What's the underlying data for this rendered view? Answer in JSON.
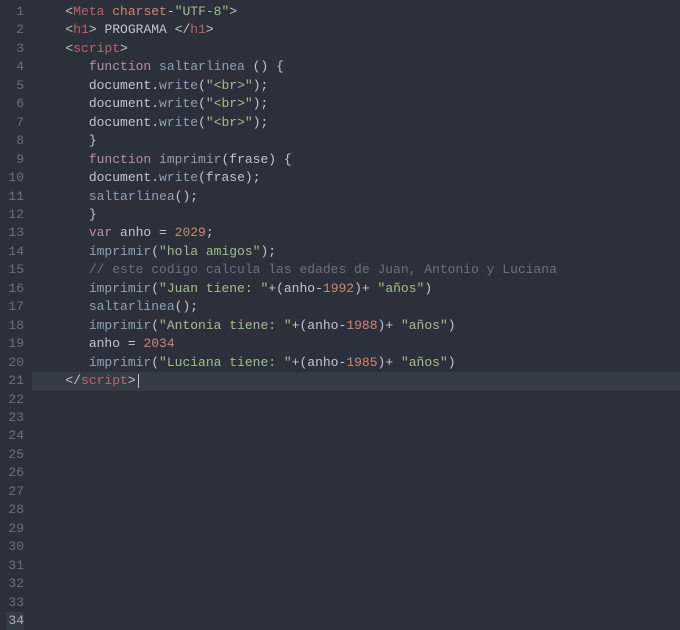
{
  "editor": {
    "active_line": 34,
    "lines": [
      {
        "n": 1,
        "indent": 1,
        "tokens": [
          {
            "c": "t-punc",
            "t": "<"
          },
          {
            "c": "t-tag",
            "t": "Meta"
          },
          {
            "c": "t-punc",
            "t": " "
          },
          {
            "c": "t-attr",
            "t": "charset"
          },
          {
            "c": "t-punc",
            "t": "-"
          },
          {
            "c": "t-str",
            "t": "\"UTF-8\""
          },
          {
            "c": "t-punc",
            "t": ">"
          }
        ]
      },
      {
        "n": 2,
        "indent": 1,
        "tokens": [
          {
            "c": "t-punc",
            "t": "<"
          },
          {
            "c": "t-tag",
            "t": "h1"
          },
          {
            "c": "t-punc",
            "t": "> "
          },
          {
            "c": "t-ident",
            "t": "PROGRAMA"
          },
          {
            "c": "t-punc",
            "t": " </"
          },
          {
            "c": "t-tag",
            "t": "h1"
          },
          {
            "c": "t-punc",
            "t": ">"
          }
        ]
      },
      {
        "n": 3,
        "indent": 0,
        "tokens": []
      },
      {
        "n": 4,
        "indent": 0,
        "tokens": []
      },
      {
        "n": 5,
        "indent": 1,
        "tokens": [
          {
            "c": "t-punc",
            "t": "<"
          },
          {
            "c": "t-tag",
            "t": "script"
          },
          {
            "c": "t-punc",
            "t": ">"
          }
        ]
      },
      {
        "n": 6,
        "indent": 0,
        "tokens": []
      },
      {
        "n": 7,
        "indent": 2,
        "tokens": [
          {
            "c": "t-kw",
            "t": "function"
          },
          {
            "c": "t-punc",
            "t": " "
          },
          {
            "c": "t-fn",
            "t": "saltarlinea"
          },
          {
            "c": "t-punc",
            "t": " () {"
          }
        ]
      },
      {
        "n": 8,
        "indent": 0,
        "tokens": []
      },
      {
        "n": 9,
        "indent": 2,
        "tokens": [
          {
            "c": "t-ident",
            "t": "document"
          },
          {
            "c": "t-punc",
            "t": "."
          },
          {
            "c": "t-fn",
            "t": "write"
          },
          {
            "c": "t-punc",
            "t": "("
          },
          {
            "c": "t-str",
            "t": "\"<br>\""
          },
          {
            "c": "t-punc",
            "t": ");"
          }
        ]
      },
      {
        "n": 10,
        "indent": 2,
        "tokens": [
          {
            "c": "t-ident",
            "t": "document"
          },
          {
            "c": "t-punc",
            "t": "."
          },
          {
            "c": "t-fn",
            "t": "write"
          },
          {
            "c": "t-punc",
            "t": "("
          },
          {
            "c": "t-str",
            "t": "\"<br>\""
          },
          {
            "c": "t-punc",
            "t": ");"
          }
        ]
      },
      {
        "n": 11,
        "indent": 2,
        "tokens": [
          {
            "c": "t-ident",
            "t": "document"
          },
          {
            "c": "t-punc",
            "t": "."
          },
          {
            "c": "t-fn",
            "t": "write"
          },
          {
            "c": "t-punc",
            "t": "("
          },
          {
            "c": "t-str",
            "t": "\"<br>\""
          },
          {
            "c": "t-punc",
            "t": ");"
          }
        ]
      },
      {
        "n": 12,
        "indent": 0,
        "tokens": []
      },
      {
        "n": 13,
        "indent": 2,
        "tokens": [
          {
            "c": "t-punc",
            "t": "}"
          }
        ]
      },
      {
        "n": 14,
        "indent": 0,
        "tokens": []
      },
      {
        "n": 15,
        "indent": 2,
        "tokens": [
          {
            "c": "t-kw",
            "t": "function"
          },
          {
            "c": "t-punc",
            "t": " "
          },
          {
            "c": "t-fn",
            "t": "ímprimir"
          },
          {
            "c": "t-punc",
            "t": "("
          },
          {
            "c": "t-ident",
            "t": "frase"
          },
          {
            "c": "t-punc",
            "t": ") {"
          }
        ]
      },
      {
        "n": 16,
        "indent": 2,
        "tokens": [
          {
            "c": "t-ident",
            "t": "document"
          },
          {
            "c": "t-punc",
            "t": "."
          },
          {
            "c": "t-fn",
            "t": "write"
          },
          {
            "c": "t-punc",
            "t": "("
          },
          {
            "c": "t-ident",
            "t": "frase"
          },
          {
            "c": "t-punc",
            "t": ");"
          }
        ]
      },
      {
        "n": 17,
        "indent": 2,
        "tokens": [
          {
            "c": "t-fn",
            "t": "saltarlinea"
          },
          {
            "c": "t-punc",
            "t": "();"
          }
        ]
      },
      {
        "n": 18,
        "indent": 2,
        "tokens": [
          {
            "c": "t-punc",
            "t": "}"
          }
        ]
      },
      {
        "n": 19,
        "indent": 0,
        "tokens": []
      },
      {
        "n": 20,
        "indent": 2,
        "tokens": [
          {
            "c": "t-kw",
            "t": "var"
          },
          {
            "c": "t-punc",
            "t": " "
          },
          {
            "c": "t-ident",
            "t": "anho"
          },
          {
            "c": "t-punc",
            "t": " = "
          },
          {
            "c": "t-num",
            "t": "2029"
          },
          {
            "c": "t-punc",
            "t": ";"
          }
        ]
      },
      {
        "n": 21,
        "indent": 0,
        "tokens": []
      },
      {
        "n": 22,
        "indent": 2,
        "tokens": [
          {
            "c": "t-fn",
            "t": "ímprimir"
          },
          {
            "c": "t-punc",
            "t": "("
          },
          {
            "c": "t-str",
            "t": "\"hola amigos\""
          },
          {
            "c": "t-punc",
            "t": ");"
          }
        ]
      },
      {
        "n": 23,
        "indent": 0,
        "tokens": []
      },
      {
        "n": 24,
        "indent": 2,
        "tokens": [
          {
            "c": "t-cmt",
            "t": "// este codigo calcula las edades de Juan, Antonio y Luciana"
          }
        ]
      },
      {
        "n": 25,
        "indent": 2,
        "tokens": [
          {
            "c": "t-fn",
            "t": "ímprimir"
          },
          {
            "c": "t-punc",
            "t": "("
          },
          {
            "c": "t-str",
            "t": "\"Juan tiene: \""
          },
          {
            "c": "t-punc",
            "t": "+("
          },
          {
            "c": "t-ident",
            "t": "anho"
          },
          {
            "c": "t-punc",
            "t": "-"
          },
          {
            "c": "t-num",
            "t": "1992"
          },
          {
            "c": "t-punc",
            "t": ")+ "
          },
          {
            "c": "t-str",
            "t": "\"años\""
          },
          {
            "c": "t-punc",
            "t": ")"
          }
        ]
      },
      {
        "n": 26,
        "indent": 2,
        "tokens": [
          {
            "c": "t-fn",
            "t": "saltarlinea"
          },
          {
            "c": "t-punc",
            "t": "();"
          }
        ]
      },
      {
        "n": 27,
        "indent": 0,
        "tokens": []
      },
      {
        "n": 28,
        "indent": 2,
        "tokens": [
          {
            "c": "t-fn",
            "t": "ímprimir"
          },
          {
            "c": "t-punc",
            "t": "("
          },
          {
            "c": "t-str",
            "t": "\"Antonia tiene: \""
          },
          {
            "c": "t-punc",
            "t": "+("
          },
          {
            "c": "t-ident",
            "t": "anho"
          },
          {
            "c": "t-punc",
            "t": "-"
          },
          {
            "c": "t-num",
            "t": "1988"
          },
          {
            "c": "t-punc",
            "t": ")+ "
          },
          {
            "c": "t-str",
            "t": "\"años\""
          },
          {
            "c": "t-punc",
            "t": ")"
          }
        ]
      },
      {
        "n": 29,
        "indent": 0,
        "tokens": []
      },
      {
        "n": 30,
        "indent": 2,
        "tokens": [
          {
            "c": "t-ident",
            "t": "anho"
          },
          {
            "c": "t-punc",
            "t": " = "
          },
          {
            "c": "t-num",
            "t": "2034"
          }
        ]
      },
      {
        "n": 31,
        "indent": 0,
        "tokens": []
      },
      {
        "n": 32,
        "indent": 2,
        "tokens": [
          {
            "c": "t-fn",
            "t": "ímprimir"
          },
          {
            "c": "t-punc",
            "t": "("
          },
          {
            "c": "t-str",
            "t": "\"Luciana tiene: \""
          },
          {
            "c": "t-punc",
            "t": "+("
          },
          {
            "c": "t-ident",
            "t": "anho"
          },
          {
            "c": "t-punc",
            "t": "-"
          },
          {
            "c": "t-num",
            "t": "1985"
          },
          {
            "c": "t-punc",
            "t": ")+ "
          },
          {
            "c": "t-str",
            "t": "\"años\""
          },
          {
            "c": "t-punc",
            "t": ")"
          }
        ]
      },
      {
        "n": 33,
        "indent": 0,
        "tokens": []
      },
      {
        "n": 34,
        "indent": 1,
        "tokens": [
          {
            "c": "t-punc",
            "t": "</"
          },
          {
            "c": "t-tag",
            "t": "script"
          },
          {
            "c": "t-punc",
            "t": ">"
          }
        ]
      }
    ]
  }
}
